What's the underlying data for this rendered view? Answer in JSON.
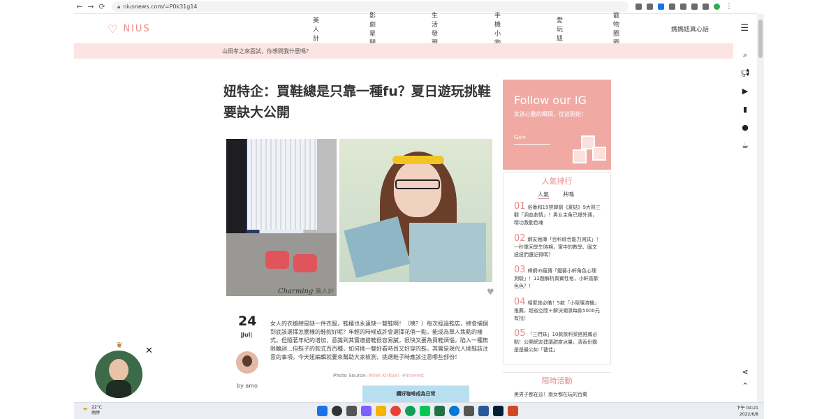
{
  "browser": {
    "back": "←",
    "forward": "→",
    "reload": "⟳",
    "url": "niusnews.com/=P0k31g14"
  },
  "site": {
    "logo": "NIUS",
    "nav": [
      "美人計",
      "影劇星聞",
      "生活發現",
      "手機小物",
      "愛玩妞",
      "寵物圈圈",
      "媽媽妞真心話"
    ],
    "announcement": "山田孝之來面試，你想問我什麼嗎？"
  },
  "article": {
    "title": "妞特企：買鞋總是只靠一種fu？夏日遊玩挑鞋要訣大公開",
    "category_script": "Charming",
    "category": "美人計",
    "day": "24",
    "month": "Jul",
    "author": "by amo",
    "body": "女人的衣櫥總是缺一件衣服，鞋櫃也永遠缺一雙鞋啊！（咦？）每次經過鞋店，總會捕個到底該選擇怎麼樣的鞋款好呢？年輕的時候或許會選擇花俏一點，能成為眾人焦點的樣式，但隨著年紀的增加，意識到其實適搭鞋很容易膩，很快又要為買鞋煩惱，陷入一種無限輪迴…但鞋子的款式百百種，如何挑一雙好看時尚又好穿的鞋，其實是現代人挑鞋該注意的事項，今天妞編輯就要來幫助大家檢測，挑選鞋子時應該注意哪些部份！",
    "photo_source_label": "Photo Source:",
    "photo_source": "Mirei Kiritani -Pinterest",
    "ad_text": "鑽好咖啡成為日常"
  },
  "sidebar": {
    "ig_title": "Follow our IG",
    "ig_sub": "女孩心動的瞬間，從這開始！",
    "ig_go": "Go>",
    "rank_title": "人氣排行",
    "tabs": [
      "人氣",
      "共鳴"
    ],
    "ranks": [
      {
        "num": "01",
        "text": "俗番和19禁韓劇《夏姑》9大熟三觀「洞血劇情」！男女主角已爆外遇，精功激動色魂"
      },
      {
        "num": "02",
        "text": "網友瘋傳「百科綜合能力測試」！一秒重回學生時期，寓中的數學、國文妞妞們還記得嗎？"
      },
      {
        "num": "03",
        "text": "韓網IG瘋傳「鐵藝小軒角色心理測驗」！12題解析真實性格，小軒喜歡色色？！"
      },
      {
        "num": "04",
        "text": "相聚旅必備！5款「小型隨濟機」推薦，超省空間＋解決潮濕每款5000元有找！"
      },
      {
        "num": "05",
        "text": "「三們妹」10款飲料菜搭推薦必點！公開網友建議甜度冰量，清香份霸是是最公如「儘佳」"
      }
    ],
    "limited_title": "限時活動",
    "limited_text": "美男子都在這！南女都在玩的百萬"
  },
  "taskbar": {
    "temp": "22°C",
    "weather": "雨停",
    "time": "下午 04:21",
    "date": "2022/6/8"
  },
  "colors": {
    "brand_pink": "#e88a8a",
    "announce_bg": "#fde4e4",
    "ig_bg": "#f1a9a4"
  }
}
